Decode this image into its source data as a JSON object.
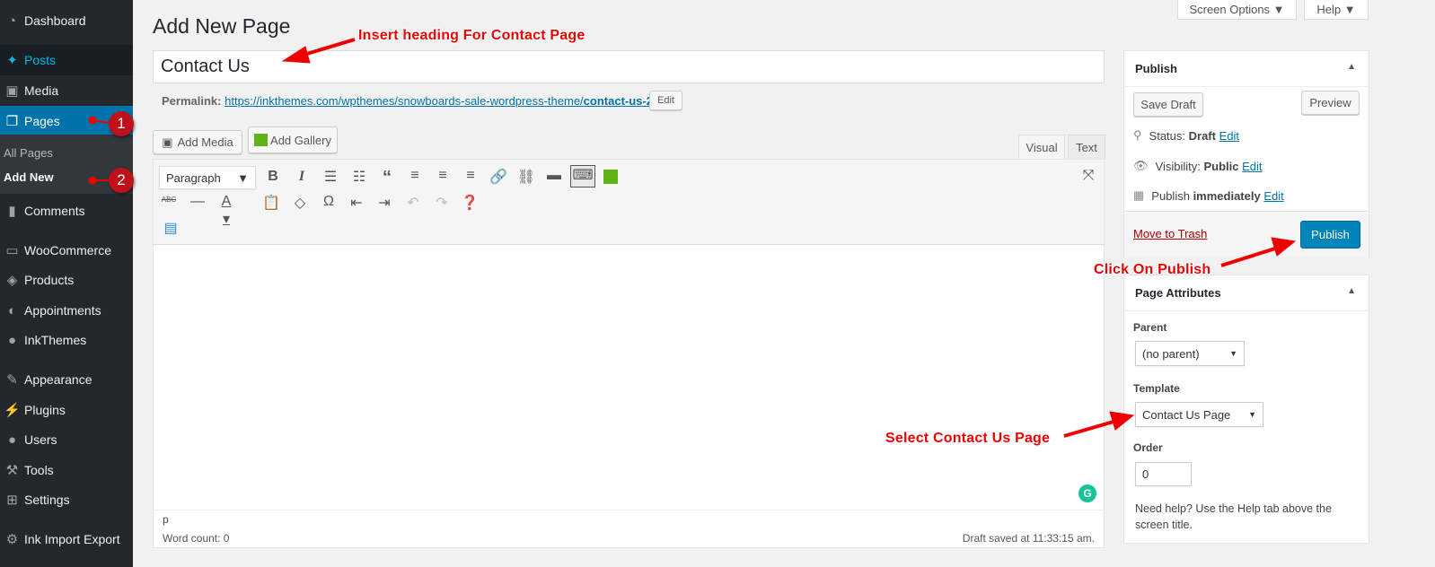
{
  "sidebar": {
    "items": [
      {
        "label": "Dashboard",
        "icon": "dashboard-icon",
        "glyph": "◔"
      },
      {
        "label": "Posts",
        "icon": "pin-icon",
        "glyph": "✦"
      },
      {
        "label": "Media",
        "icon": "media-icon",
        "glyph": "▣"
      },
      {
        "label": "Pages",
        "icon": "pages-icon",
        "glyph": "❐"
      },
      {
        "label": "Comments",
        "icon": "comment-icon",
        "glyph": "▮"
      },
      {
        "label": "WooCommerce",
        "icon": "woo-icon",
        "glyph": "▭"
      },
      {
        "label": "Products",
        "icon": "box-icon",
        "glyph": "◈"
      },
      {
        "label": "Appointments",
        "icon": "appointments-icon",
        "glyph": "◐"
      },
      {
        "label": "InkThemes",
        "icon": "inkthemes-icon",
        "glyph": "●"
      },
      {
        "label": "Appearance",
        "icon": "brush-icon",
        "glyph": "✎"
      },
      {
        "label": "Plugins",
        "icon": "plug-icon",
        "glyph": "⚡"
      },
      {
        "label": "Users",
        "icon": "user-icon",
        "glyph": "●"
      },
      {
        "label": "Tools",
        "icon": "wrench-icon",
        "glyph": "⚒"
      },
      {
        "label": "Settings",
        "icon": "settings-icon",
        "glyph": "⊞"
      },
      {
        "label": "Ink Import Export",
        "icon": "gear-icon",
        "glyph": "⚙"
      }
    ],
    "submenu": [
      "All Pages",
      "Add New"
    ],
    "badges": [
      "1",
      "2"
    ]
  },
  "top": {
    "screen_options": "Screen Options ▼",
    "help": "Help ▼"
  },
  "page": {
    "title": "Add New Page",
    "post_title": "Contact Us",
    "permalink_label": "Permalink:",
    "permalink_base": "https://inkthemes.com/wpthemes/snowboards-sale-wordpress-theme/",
    "permalink_slug": "contact-us-2/",
    "edit": "Edit"
  },
  "editor": {
    "add_media": "Add Media",
    "add_gallery": "Add Gallery",
    "tab_visual": "Visual",
    "tab_text": "Text",
    "format": "Paragraph",
    "path": "p",
    "word_count": "Word count: 0",
    "draft_saved": "Draft saved at 11:33:15 am."
  },
  "publish": {
    "title": "Publish",
    "save_draft": "Save Draft",
    "preview": "Preview",
    "status_label": "Status:",
    "status": "Draft",
    "visibility_label": "Visibility:",
    "visibility": "Public",
    "publish_label": "Publish",
    "publish_when": "immediately",
    "edit": "Edit",
    "trash": "Move to Trash",
    "publish_button": "Publish"
  },
  "attributes": {
    "title": "Page Attributes",
    "parent_label": "Parent",
    "parent": "(no parent)",
    "template_label": "Template",
    "template": "Contact Us Page",
    "order_label": "Order",
    "order": "0",
    "help": "Need help? Use the Help tab above the screen title."
  },
  "annotations": {
    "heading": "Insert heading For Contact Page",
    "publish": "Click On Publish",
    "template": "Select Contact Us Page"
  },
  "colors": {
    "sidebar": "#23282d",
    "accent": "#0073aa",
    "annotation": "#ee0000"
  }
}
